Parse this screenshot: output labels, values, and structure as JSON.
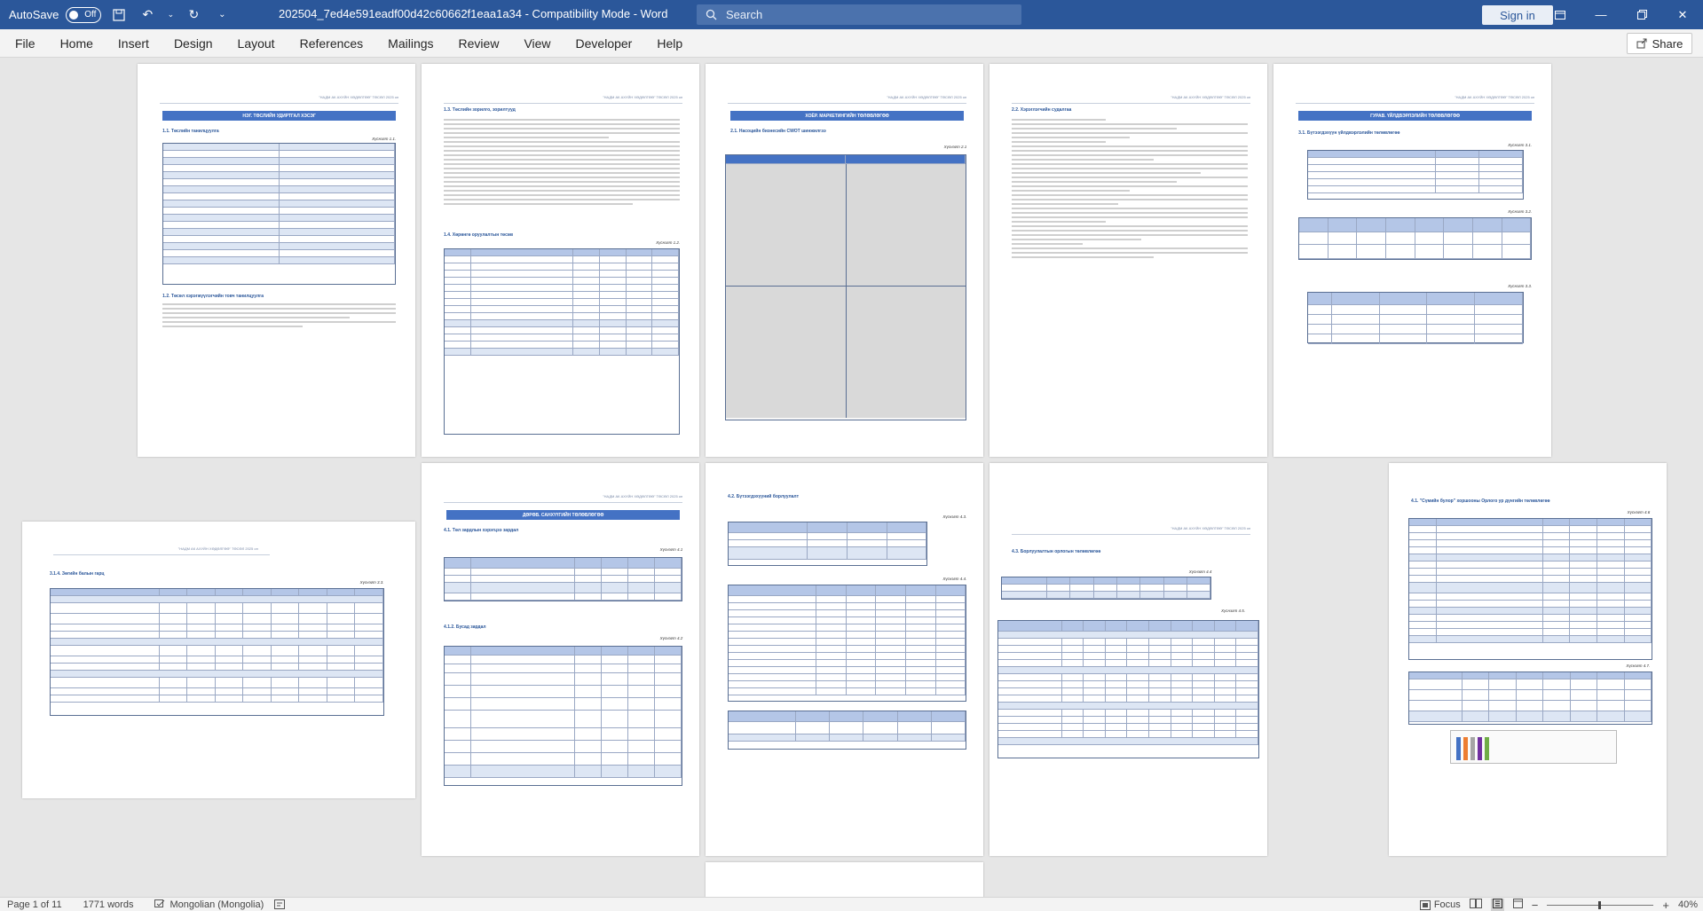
{
  "titlebar": {
    "autosave_label": "AutoSave",
    "autosave_state": "Off",
    "doc_title": "202504_7ed4e591eadf00d42c60662f1eaa1a34  -  Compatibility Mode  -  Word",
    "search_placeholder": "Search",
    "signin_label": "Sign in",
    "accent_color": "#2b579a"
  },
  "ribbon": {
    "tabs": [
      "File",
      "Home",
      "Insert",
      "Design",
      "Layout",
      "References",
      "Mailings",
      "Review",
      "View",
      "Developer",
      "Help"
    ],
    "share_label": "Share"
  },
  "pages": {
    "header_text": "\"НАДМ АК АХУЙН ХӨДӨЛГӨӨ\" ТӨСӨЛ 2025 он",
    "p1": {
      "band": "НЭГ. ТӨСЛИЙН УДИРТГАЛ ХЭСЭГ",
      "sub1": "1.1.   Төслийн танилцуулга",
      "cap1": "Хүснэгт 1.1.",
      "sub2": "1.2.   Төсөл хэрэгжүүлэгчийн товч танилцуулга"
    },
    "p2": {
      "sub1": "1.3.   Төслийн зорилго, зорилтууд",
      "sub2": "1.4.   Хөрөнгө оруулалтын төсөв",
      "cap1": "Хүснэгт 1.2."
    },
    "p3": {
      "band": "ХОЁР. МАРКЕТИНГИЙН ТӨЛӨВЛӨГӨӨ",
      "sub1": "2.1.   Насоцийн бизнесийн СWOT шинжилгээ",
      "cap1": "Хүснэгт 2.1"
    },
    "p4": {
      "sub1": "2.2. Хэрэглэгчийн судалгаа"
    },
    "p5": {
      "band": "ГУРАВ. ҮЙЛДВЭРЛЭЛИЙН ТӨЛӨВЛӨГӨӨ",
      "sub1": "3.1. Бүтээгдэхүүн үйлдвэрлэлийн төлөвлөгөө",
      "cap1": "Хүснэгт 3.1.",
      "cap2": "Хүснэгт 3.2.",
      "cap3": "Хүснэгт 3.3."
    },
    "p6": {
      "sub1": "3.1.4.  Зөгийн балын гарц",
      "cap1": "Хүснэгт 3.3."
    },
    "p7": {
      "band": "ДӨРӨВ. САНХҮҮГИЙН ТӨЛӨВЛӨГӨӨ",
      "sub1": "4.1.   Төл зардлын хэрэгцээ зардал",
      "cap1": "Хүснэгт 4.1",
      "sub2": "4.1.2. Бусад зардал",
      "cap2": "Хүснэгт 4.2"
    },
    "p8": {
      "sub1": "4.2. Бүтээгдэхүүний борлуулалт",
      "cap1": "Хүснэгт 4.3.",
      "cap2": "Хүснэгт 4.4."
    },
    "p9": {
      "sub1": "4.3.   Борлуулалтын орлогын төлөвлөгөө",
      "cap1": "Хүснэгт 4.4",
      "cap2": "Хүснэгт 4.5."
    },
    "p10": {
      "sub1": "4.1.   \"Сүмийн булор\" хоршооны Орлого ур дүнгийн төлөвлөгөө",
      "cap1": "Хүснэгт 4.6",
      "cap2": "Хүснэгт 4.7."
    }
  },
  "status": {
    "page": "Page 1 of 11",
    "words": "1771 words",
    "language": "Mongolian (Mongolia)",
    "focus_label": "Focus",
    "zoom": "40%"
  }
}
